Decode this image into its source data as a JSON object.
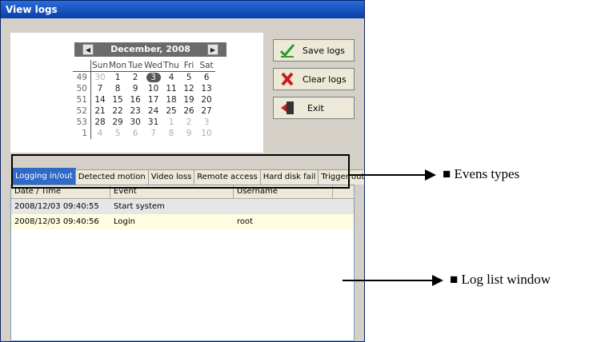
{
  "window": {
    "title": "View logs"
  },
  "calendar": {
    "month_label": "December, 2008",
    "prev_icon": "triangle-left-icon",
    "next_icon": "triangle-right-icon",
    "day_headers": [
      "Sun",
      "Mon",
      "Tue",
      "Wed",
      "Thu",
      "Fri",
      "Sat"
    ],
    "weeks": [
      {
        "num": "49",
        "days": [
          "30",
          "1",
          "2",
          "3",
          "4",
          "5",
          "6"
        ]
      },
      {
        "num": "50",
        "days": [
          "7",
          "8",
          "9",
          "10",
          "11",
          "12",
          "13"
        ]
      },
      {
        "num": "51",
        "days": [
          "14",
          "15",
          "16",
          "17",
          "18",
          "19",
          "20"
        ]
      },
      {
        "num": "52",
        "days": [
          "21",
          "22",
          "23",
          "24",
          "25",
          "26",
          "27"
        ]
      },
      {
        "num": "53",
        "days": [
          "28",
          "29",
          "30",
          "31",
          "1",
          "2",
          "3"
        ]
      },
      {
        "num": "1",
        "days": [
          "4",
          "5",
          "6",
          "7",
          "8",
          "9",
          "10"
        ]
      }
    ],
    "selected_day": "3"
  },
  "buttons": {
    "save_label": "Save logs",
    "clear_label": "Clear logs",
    "exit_label": "Exit"
  },
  "tabs": [
    "Logging in/out",
    "Detected motion",
    "Video loss",
    "Remote access",
    "Hard disk fail",
    "Trigger outp"
  ],
  "log_list": {
    "columns": [
      "Date / Time",
      "Event",
      "Username"
    ],
    "rows": [
      {
        "datetime": "2008/12/03 09:40:55",
        "event": "Start system",
        "username": ""
      },
      {
        "datetime": "2008/12/03 09:40:56",
        "event": "Login",
        "username": "root"
      }
    ]
  },
  "annotations": {
    "event_types": "Evens types",
    "log_list_window": "Log list window"
  }
}
